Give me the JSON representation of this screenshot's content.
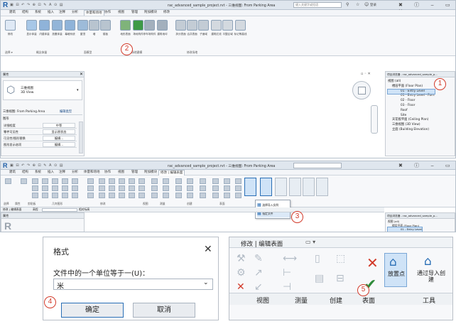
{
  "top_window": {
    "title": "rac_advanced_sample_project.rvt - 三维视图: From Parking Area",
    "search_placeholder": "键入关键字或短语",
    "user": "登录",
    "tabs": [
      "建筑",
      "结构",
      "系统",
      "插入",
      "注释",
      "分析",
      "体量和场地",
      "协作",
      "视图",
      "管理",
      "附加模块",
      "修改"
    ],
    "active_tab": "体量和场地",
    "ribbon_buttons": [
      "修改",
      "显示体量",
      "内建体量",
      "放置体量",
      "幕墙系统",
      "屋顶",
      "墙",
      "楼板",
      "地形表面",
      "场地构件",
      "停车场构件",
      "建筑地坪",
      "拆分表面",
      "合并表面",
      "子面域",
      "建筑红线",
      "平整区域",
      "标记等高线"
    ],
    "group_labels": [
      "选择 ▾",
      "概念体量",
      "面模型",
      "场地建模",
      "修改场地"
    ],
    "properties": {
      "title": "属性",
      "type_name": "三维视图",
      "type_sub": "3D View",
      "instance": "三维视图: From Parking Area",
      "edit_type": "编辑类型",
      "section": "图形",
      "rows": [
        {
          "k": "详细程度",
          "v": "中等"
        },
        {
          "k": "零件可见性",
          "v": "显示原状态"
        },
        {
          "k": "可见性/图形替换",
          "v": "编辑..."
        },
        {
          "k": "图形显示选项",
          "v": "编辑..."
        }
      ]
    },
    "browser": {
      "title": "项目浏览器 - rac_advanced_sample_p...",
      "items": [
        "视图 (all)",
        "楼层平面 (Floor Plan)",
        "01 - Entry Level",
        "01 - Entry Level - Furn",
        "02 - Floor",
        "03 - Floor",
        "Roof",
        "Site",
        "天花板平面 (Ceiling Plan)",
        "三维视图 (3D View)",
        "立面 (Building Elevation)"
      ]
    }
  },
  "second_window": {
    "title": "rac_advanced_sample_project.rvt - 三维视图: From Parking Area",
    "context_tab": "修改 | 编辑表面",
    "dropdown_items": [
      "选择导入实例",
      "指定文件"
    ],
    "group_labels": [
      "选择",
      "属性",
      "剪贴板",
      "几何图形",
      "修改",
      "视图",
      "测量",
      "创建",
      "表面",
      "工具"
    ],
    "status_left": "修改 | 编辑表面",
    "status_value": "高程",
    "status_right": "相对标高",
    "browser_title": "项目浏览器 - rac_advanced_sample_p...",
    "browser_items": [
      "视图 (all)",
      "楼层平面 (Floor Plan)",
      "01 - Entry Level"
    ]
  },
  "dialog": {
    "title": "格式",
    "label": "文件中的一个单位等于一(U)：",
    "unit": "米",
    "ok": "确定",
    "cancel": "取消"
  },
  "zoom_ribbon": {
    "context_tab": "修改 | 编辑表面",
    "place_point": "放置点",
    "import_create": "通过导入创建",
    "groups": [
      "视图",
      "测量",
      "创建",
      "表面",
      "工具"
    ]
  },
  "callouts": [
    "1",
    "2",
    "3",
    "4",
    "5"
  ],
  "colors": {
    "callout": "#d23a2a",
    "accent_blue": "#2a6fb6",
    "ribbon_bg": "#f7f8fa",
    "active_button_bg": "#cfe3f7"
  }
}
